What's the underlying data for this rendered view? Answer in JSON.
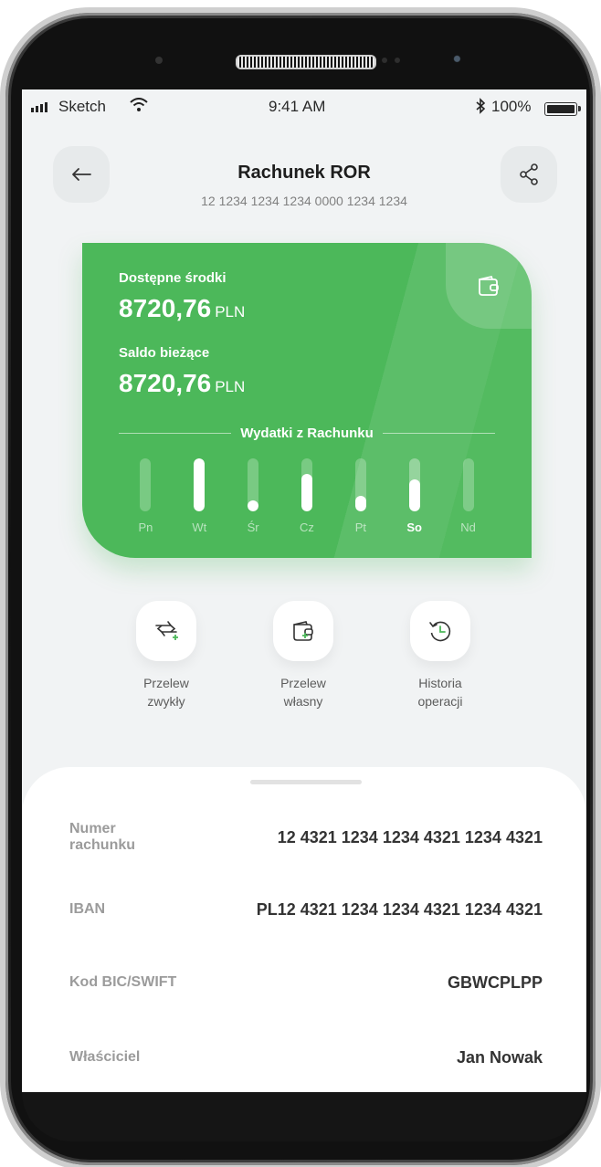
{
  "status_bar": {
    "carrier": "Sketch",
    "time": "9:41 AM",
    "battery": "100%"
  },
  "header": {
    "title": "Rachunek ROR",
    "account_number": "12 1234 1234 1234 0000 1234 1234"
  },
  "card": {
    "available_label": "Dostępne środki",
    "available_amount": "8720,76",
    "available_currency": "PLN",
    "balance_label": "Saldo bieżące",
    "balance_amount": "8720,76",
    "balance_currency": "PLN",
    "chart_title": "Wydatki z Rachunku",
    "color": "#4cb85a"
  },
  "spending_chart": {
    "days": [
      "Pn",
      "Wt",
      "Śr",
      "Cz",
      "Pt",
      "So",
      "Nd"
    ],
    "levels": [
      0,
      1.0,
      0.2,
      0.7,
      0.3,
      0.6,
      0
    ],
    "selected": "So"
  },
  "actions": [
    {
      "line1": "Przelew",
      "line2": "zwykły",
      "icon": "transfer-icon"
    },
    {
      "line1": "Przelew",
      "line2": "własny",
      "icon": "wallet-plus-icon"
    },
    {
      "line1": "Historia",
      "line2": "operacji",
      "icon": "history-icon"
    }
  ],
  "details": [
    {
      "key1": "Numer",
      "key2": "rachunku",
      "value": "12 4321 1234 1234 4321 1234 4321"
    },
    {
      "key1": "IBAN",
      "key2": "",
      "value": "PL12 4321 1234 1234 4321 1234 4321"
    },
    {
      "key1": "Kod BIC/SWIFT",
      "key2": "",
      "value": "GBWCPLPP"
    },
    {
      "key1": "Właściciel",
      "key2": "",
      "value": "Jan Nowak"
    }
  ]
}
